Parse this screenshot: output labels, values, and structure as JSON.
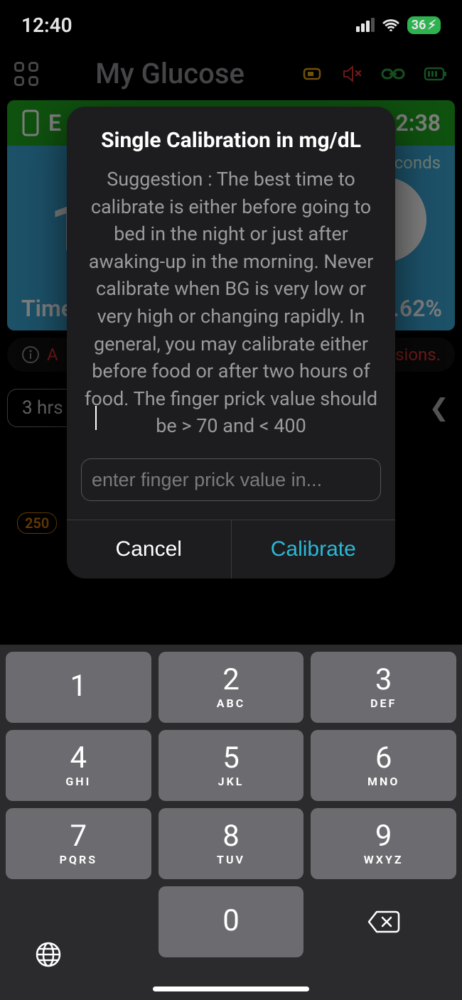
{
  "status": {
    "time": "12:40",
    "battery": "36",
    "charging_glyph": "⚡︎"
  },
  "app": {
    "title": "My Glucose",
    "band_left": "E",
    "band_right": "2:38",
    "big_value": "1",
    "panel_label": "Time",
    "panel_pct": ".62%",
    "panel_seconds": "conds",
    "warn_left": "A",
    "warn_right": "cisions.",
    "chip_3h": "3 hrs",
    "ytick_250": "250"
  },
  "dialog": {
    "title": "Single Calibration in mg/dL",
    "body": "Suggestion : The best time to calibrate is either before going to bed in the night or just after awaking-up in the morning. Never calibrate when BG is very low or very high or changing rapidly. In general, you may calibrate either before food or after two hours of food. The finger prick value should be  > 70 and  < 400",
    "placeholder": "enter finger prick value in...",
    "value": "",
    "cancel": "Cancel",
    "calibrate": "Calibrate"
  },
  "keys": {
    "k1": {
      "n": "1",
      "s": ""
    },
    "k2": {
      "n": "2",
      "s": "ABC"
    },
    "k3": {
      "n": "3",
      "s": "DEF"
    },
    "k4": {
      "n": "4",
      "s": "GHI"
    },
    "k5": {
      "n": "5",
      "s": "JKL"
    },
    "k6": {
      "n": "6",
      "s": "MNO"
    },
    "k7": {
      "n": "7",
      "s": "PQRS"
    },
    "k8": {
      "n": "8",
      "s": "TUV"
    },
    "k9": {
      "n": "9",
      "s": "WXYZ"
    },
    "k0": {
      "n": "0",
      "s": ""
    }
  }
}
